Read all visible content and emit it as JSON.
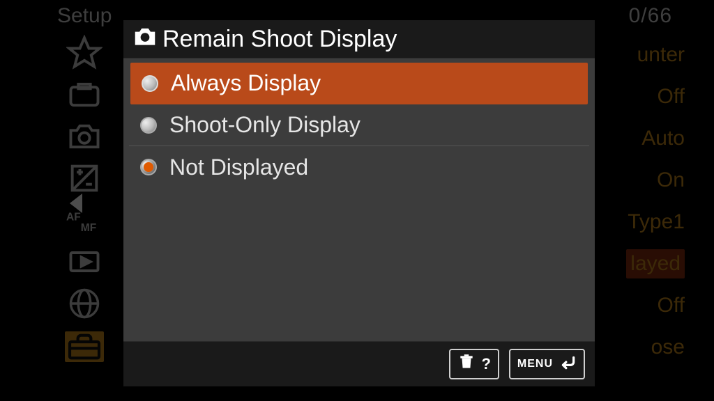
{
  "background": {
    "breadcrumb": "Setup",
    "page_counter": "0/66",
    "values": [
      "unter",
      "Off",
      "Auto",
      "On",
      "Type1",
      "layed",
      "Off",
      "ose"
    ]
  },
  "dialog": {
    "title": "Remain Shoot Display",
    "options": [
      {
        "label": "Always Display"
      },
      {
        "label": "Shoot-Only Display"
      },
      {
        "label": "Not Displayed"
      }
    ],
    "highlighted_index": 0,
    "current_value_index": 2
  },
  "footer": {
    "help_symbol": "?",
    "menu_label": "MENU"
  }
}
